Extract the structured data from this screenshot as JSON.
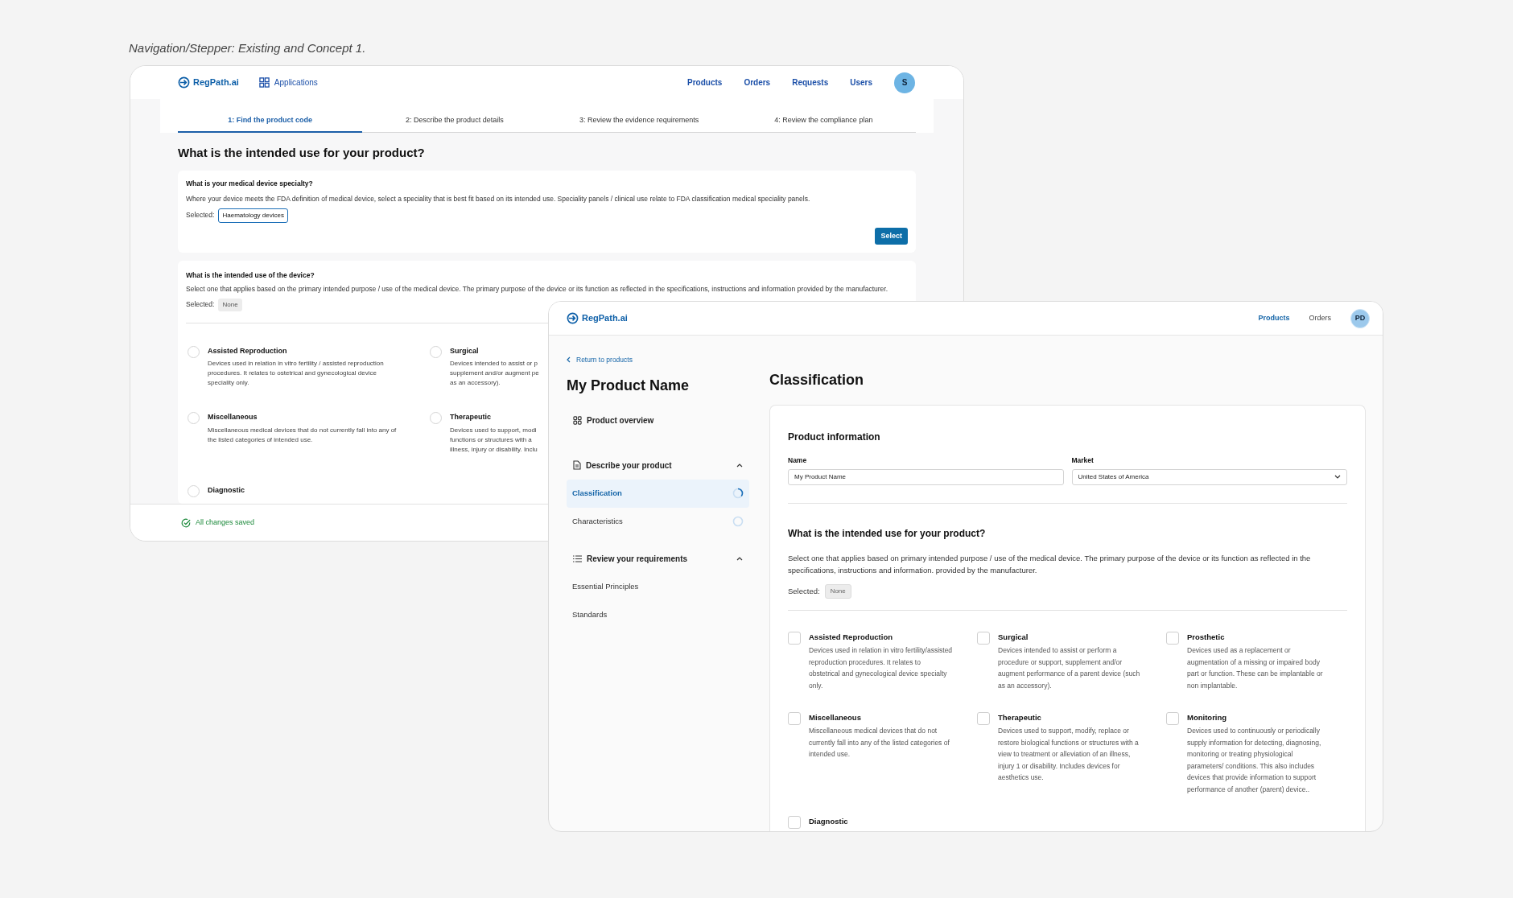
{
  "caption": "Navigation/Stepper: Existing and Concept 1.",
  "existing_window": {
    "logo": "RegPath.ai",
    "apps_link": "Applications",
    "nav": [
      {
        "label": "Products"
      },
      {
        "label": "Orders"
      },
      {
        "label": "Requests"
      },
      {
        "label": "Users"
      }
    ],
    "avatar": "S",
    "steps": [
      {
        "label": "1: Find the product code",
        "selected": true
      },
      {
        "label": "2: Describe the product details",
        "selected": false
      },
      {
        "label": "3: Review the evidence requirements",
        "selected": false
      },
      {
        "label": "4: Review the compliance plan",
        "selected": false
      }
    ],
    "heading": "What is the intended use for your product?",
    "specialty": {
      "title": "What is your medical device specialty?",
      "description": "Where your device meets the FDA definition of medical device, select a speciality that is best fit based on its intended use. Speciality panels / clinical use relate to FDA classification medical speciality panels.",
      "selected_label": "Selected:",
      "selected_value": "Haematology devices",
      "button": "Select"
    },
    "intended_use": {
      "title": "What is the intended use of the device?",
      "description": "Select one that applies based on the primary intended purpose / use of the medical device. The primary purpose of the device or its function as reflected in the specifications, instructions and information provided by the manufacturer.",
      "selected_label": "Selected:",
      "selected_value": "None",
      "options": [
        {
          "title": "Assisted Reproduction",
          "lines": [
            "Devices used in relation in vitro fertility / assisted reproduction",
            "procedures. It relates to ostetrical and gynecological device",
            "speciality only."
          ],
          "selected": false
        },
        {
          "title": "Surgical",
          "lines": [
            "Devices intended to assist or p",
            "supplement and/or augment pe",
            "as an accessory)."
          ],
          "selected": false
        },
        {
          "title": "Miscellaneous",
          "lines": [
            "Miscellaneous medical devices that do not currently fall into any of",
            "the listed categories of intended use."
          ],
          "selected": false
        },
        {
          "title": "Therapeutic",
          "lines": [
            "Devices used to support, modi",
            "functions or structures with a",
            "illness, injury or disability. Inclu"
          ],
          "selected": false
        },
        {
          "title": "Diagnostic",
          "selected": false
        }
      ]
    },
    "status": "All changes saved"
  },
  "concept_window": {
    "logo": "RegPath.ai",
    "nav": [
      {
        "label": "Products",
        "selected": true
      },
      {
        "label": "Orders",
        "selected": false
      }
    ],
    "avatar": "PD",
    "back_link": "Return to products",
    "product_name": "My Product Name",
    "sidebar": [
      {
        "kind": "overview",
        "label": "Product overview"
      },
      {
        "kind": "section",
        "label": "Describe your product",
        "expanded": true
      },
      {
        "kind": "step",
        "label": "Classification",
        "selected": true,
        "in_progress": true
      },
      {
        "kind": "step",
        "label": "Characteristics",
        "selected": false,
        "in_progress": false
      },
      {
        "kind": "section",
        "label": "Review your requirements",
        "expanded": true
      },
      {
        "kind": "link",
        "label": "Essential Principles"
      },
      {
        "kind": "link",
        "label": "Standards"
      }
    ],
    "page_title": "Classification",
    "card": {
      "title": "Product information",
      "fields": [
        {
          "kind": "text",
          "label": "Name",
          "value": "My Product Name"
        },
        {
          "kind": "select",
          "label": "Market",
          "value": "United States of America"
        }
      ],
      "question": "What is the intended use for your product?",
      "description": "Select one that applies based on primary intended purpose / use of the medical device. The primary purpose of the device or its function as reflected in the specifications, instructions and information. provided by the manufacturer.",
      "selected_label": "Selected:",
      "selected_value": "None",
      "options": [
        {
          "title": "Assisted Reproduction",
          "description": "Devices used in relation in vitro fertility/assisted reproduction procedures. It relates to obstetrical and gynecological device specialty only.",
          "checked": false
        },
        {
          "title": "Surgical",
          "description": "Devices intended to assist or perform a procedure or support, supplement and/or augment performance of a parent device (such as an accessory).",
          "checked": false
        },
        {
          "title": "Prosthetic",
          "description": "Devices used as a replacement or augmentation of a missing or impaired body part or function. These can be implantable or non implantable.",
          "checked": false
        },
        {
          "title": "Miscellaneous",
          "description": "Miscellaneous medical devices that do not currently fall into any of the listed categories of intended use.",
          "checked": false
        },
        {
          "title": "Therapeutic",
          "description": "Devices used to support, modify, replace or restore biological functions or structures with a view to treatment or alleviation of an illness, injury 1  or disability. Includes devices for aesthetics use.",
          "checked": false
        },
        {
          "title": "Monitoring",
          "description": "Devices used to continuously or periodically supply information for detecting, diagnosing, monitoring or treating physiological parameters/ conditions. This also includes devices that provide information to support performance of another (parent) device..",
          "checked": false
        },
        {
          "title": "Diagnostic",
          "checked": false
        }
      ]
    }
  }
}
